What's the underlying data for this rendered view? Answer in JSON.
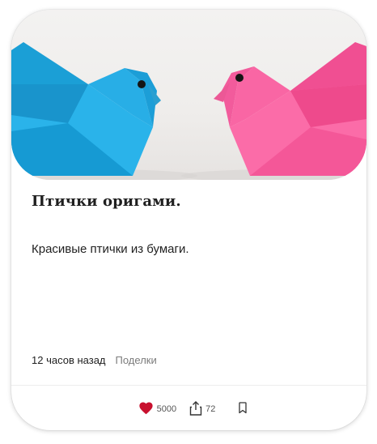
{
  "post": {
    "title": "Птички оригами.",
    "description": "Красивые птички из бумаги.",
    "time_ago": "12 часов назад",
    "category": "Поделки"
  },
  "actions": {
    "likes": "5000",
    "shares": "72"
  },
  "colors": {
    "like_heart": "#c8102e",
    "bird_left": "#1ea8e0",
    "bird_right": "#f7609f"
  }
}
